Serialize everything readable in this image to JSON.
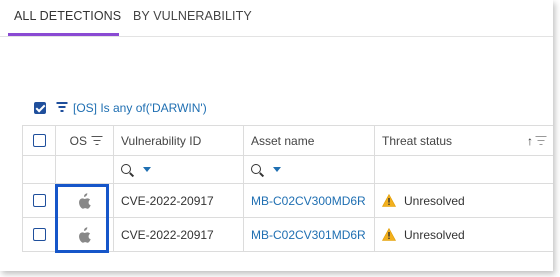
{
  "tabs": [
    {
      "label": "ALL DETECTIONS",
      "active": true
    },
    {
      "label": "BY VULNERABILITY",
      "active": false
    }
  ],
  "filter": {
    "text": "[OS] Is any of('DARWIN')",
    "checked": true
  },
  "table": {
    "headers": {
      "os": "OS",
      "vulnerability_id": "Vulnerability ID",
      "asset_name": "Asset name",
      "threat_status": "Threat status"
    },
    "rows": [
      {
        "os_icon": "apple-icon",
        "vulnerability_id": "CVE-2022-20917",
        "asset_name": "MB-C02CV300MD6R",
        "threat_status": "Unresolved",
        "status_icon": "warning-icon"
      },
      {
        "os_icon": "apple-icon",
        "vulnerability_id": "CVE-2022-20917",
        "asset_name": "MB-C02CV301MD6R",
        "threat_status": "Unresolved",
        "status_icon": "warning-icon"
      }
    ]
  },
  "colors": {
    "accent_tab": "#8a4ad3",
    "link": "#1f6fb2",
    "checkbox": "#1f4f9c",
    "highlight": "#1656c9",
    "warning": "#f2b01e"
  }
}
